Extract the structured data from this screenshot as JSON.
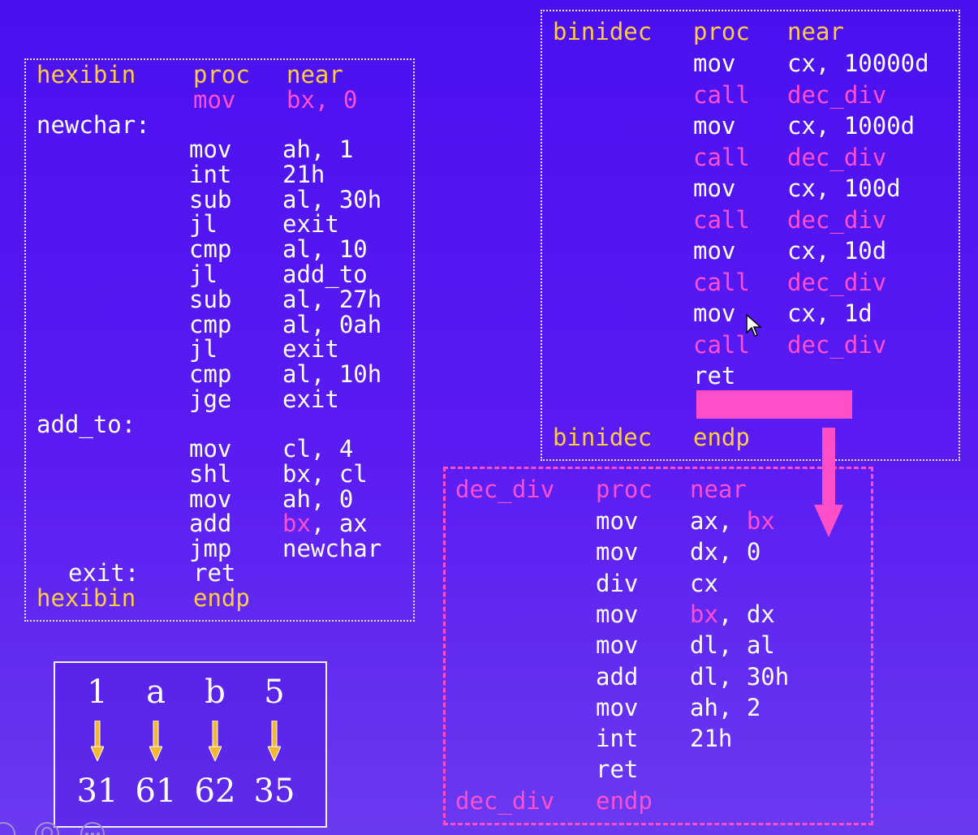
{
  "hexibin": {
    "header_label": "hexibin",
    "header_op": "proc",
    "header_arg": "near",
    "init_op": "mov",
    "init_arg": "bx, 0",
    "newchar_label": "newchar:",
    "lines1": [
      {
        "op": "mov",
        "arg": "ah, 1"
      },
      {
        "op": "int",
        "arg": "21h"
      },
      {
        "op": "sub",
        "arg": "al, 30h"
      },
      {
        "op": "jl",
        "arg": "exit"
      },
      {
        "op": "cmp",
        "arg": "al, 10"
      },
      {
        "op": "jl",
        "arg": "add_to"
      },
      {
        "op": "sub",
        "arg": "al, 27h"
      },
      {
        "op": "cmp",
        "arg": "al, 0ah"
      },
      {
        "op": "jl",
        "arg": "exit"
      },
      {
        "op": "cmp",
        "arg": "al, 10h"
      },
      {
        "op": "jge",
        "arg": "exit"
      }
    ],
    "addto_label": "add_to:",
    "lines2": [
      {
        "op": "mov",
        "arg": "cl, 4"
      },
      {
        "op": "shl",
        "arg": "bx, cl"
      },
      {
        "op": "mov",
        "arg": "ah, 0"
      }
    ],
    "add_op": "add",
    "add_arg_hl": "bx",
    "add_arg_rest": ", ax",
    "jmp_op": "jmp",
    "jmp_arg": "newchar",
    "exit_label": "exit:",
    "exit_op": "ret",
    "footer_label": "hexibin",
    "footer_op": "endp"
  },
  "binidec": {
    "header_label": "binidec",
    "header_op": "proc",
    "header_arg": "near",
    "lines": [
      {
        "op": "mov",
        "arg": "cx, 10000d",
        "highlight": false
      },
      {
        "op": "call",
        "arg": "dec_div",
        "highlight": true
      },
      {
        "op": "mov",
        "arg": "cx, 1000d",
        "highlight": false
      },
      {
        "op": "call",
        "arg": "dec_div",
        "highlight": true
      },
      {
        "op": "mov",
        "arg": "cx, 100d",
        "highlight": false
      },
      {
        "op": "call",
        "arg": "dec_div",
        "highlight": true
      },
      {
        "op": "mov",
        "arg": "cx, 10d",
        "highlight": false
      },
      {
        "op": "call",
        "arg": "dec_div",
        "highlight": true
      },
      {
        "op": "mov",
        "arg": "cx, 1d",
        "highlight": false
      },
      {
        "op": "call",
        "arg": "dec_div",
        "highlight": true
      },
      {
        "op": "ret",
        "arg": "",
        "highlight": false
      }
    ],
    "footer_label": "binidec",
    "footer_op": "endp"
  },
  "dec_div": {
    "header_label": "dec_div",
    "header_op": "proc",
    "header_arg": "near",
    "lines": [
      {
        "op": "mov",
        "arg_hl_first": "",
        "arg_pre": "ax, ",
        "arg_hl": "bx",
        "arg_post": ""
      },
      {
        "op": "mov",
        "arg_hl_first": "",
        "arg_pre": "dx, 0",
        "arg_hl": "",
        "arg_post": ""
      },
      {
        "op": "div",
        "arg_hl_first": "",
        "arg_pre": "cx",
        "arg_hl": "",
        "arg_post": ""
      },
      {
        "op": "mov",
        "arg_hl_first": "bx",
        "arg_pre": "",
        "arg_hl": "",
        "arg_post": ", dx"
      },
      {
        "op": "mov",
        "arg_hl_first": "",
        "arg_pre": "dl, al",
        "arg_hl": "",
        "arg_post": ""
      },
      {
        "op": "add",
        "arg_hl_first": "",
        "arg_pre": "dl, 30h",
        "arg_hl": "",
        "arg_post": ""
      },
      {
        "op": "mov",
        "arg_hl_first": "",
        "arg_pre": "ah, 2",
        "arg_hl": "",
        "arg_post": ""
      },
      {
        "op": "int",
        "arg_hl_first": "",
        "arg_pre": "21h",
        "arg_hl": "",
        "arg_post": ""
      },
      {
        "op": "ret",
        "arg_hl_first": "",
        "arg_pre": "",
        "arg_hl": "",
        "arg_post": ""
      }
    ],
    "footer_label": "dec_div",
    "footer_op": "endp"
  },
  "ascii_table": {
    "chars": [
      "1",
      "a",
      "b",
      "5"
    ],
    "codes": [
      "31",
      "61",
      "62",
      "35"
    ]
  },
  "colors": {
    "background": "#4a10f0",
    "keyword_yellow": "#ffcc44",
    "highlight_pink": "#ff4fd0",
    "text_white": "#ffffff",
    "arrow_orange": "#f5b730"
  },
  "icons": [
    "mouse-cursor-icon",
    "down-arrow-icon",
    "player-control-icon"
  ]
}
